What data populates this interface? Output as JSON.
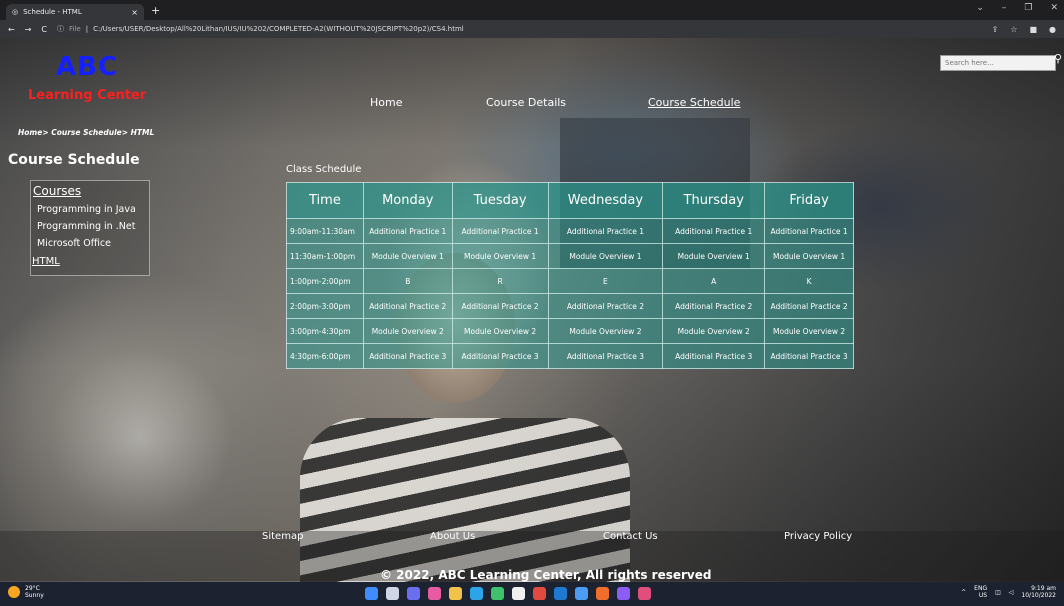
{
  "browser": {
    "tab_title": "Schedule - HTML",
    "tab_close": "×",
    "new_tab": "+",
    "url_prefix": "File",
    "url": "C:/Users/USER/Desktop/All%20Lithan/IUS/IU%202/COMPLETED-A2(WITHOUT%20JSCRIPT%20p2)/CS4.html"
  },
  "header": {
    "logo": "ABC",
    "logo_sub": "Learning Center",
    "search_placeholder": "Search here...",
    "nav": [
      "Home",
      "Course Details",
      "Course Schedule"
    ]
  },
  "breadcrumb": "Home> Course Schedule> HTML",
  "sidebar": {
    "title": "Course Schedule",
    "courses_label": "Courses",
    "items": [
      "Programming in Java",
      "Programming in .Net",
      "Microsoft Office"
    ],
    "current": "HTML"
  },
  "schedule": {
    "caption": "Class Schedule",
    "columns": [
      "Time",
      "Monday",
      "Tuesday",
      "Wednesday",
      "Thursday",
      "Friday"
    ],
    "rows": [
      [
        "9:00am-11:30am",
        "Additional Practice 1",
        "Additional Practice 1",
        "Additional Practice 1",
        "Additional Practice 1",
        "Additional Practice 1"
      ],
      [
        "11:30am-1:00pm",
        "Module Overview 1",
        "Module Overview 1",
        "Module Overview 1",
        "Module Overview 1",
        "Module Overview 1"
      ],
      [
        "1:00pm-2:00pm",
        "B",
        "R",
        "E",
        "A",
        "K"
      ],
      [
        "2:00pm-3:00pm",
        "Additional Practice 2",
        "Additional Practice 2",
        "Additional Practice 2",
        "Additional Practice 2",
        "Additional Practice 2"
      ],
      [
        "3:00pm-4:30pm",
        "Module Overview 2",
        "Module Overview 2",
        "Module Overview 2",
        "Module Overview 2",
        "Module Overview 2"
      ],
      [
        "4:30pm-6:00pm",
        "Additional Practice 3",
        "Additional Practice 3",
        "Additional Practice 3",
        "Additional Practice 3",
        "Additional Practice 3"
      ]
    ]
  },
  "footer": {
    "links": [
      "Sitemap",
      "About Us",
      "Contact Us",
      "Privacy Policy"
    ],
    "copyright": "© 2022, ABC Learning Center, All rights reserved"
  },
  "taskbar": {
    "temp": "29°C",
    "weather": "Sunny",
    "lang": "ENG",
    "region": "US",
    "time": "9:19 am",
    "date": "10/10/2022"
  },
  "colors": {
    "logo": "#1420ff",
    "logo_sub": "#ff1e1e",
    "table_teal": "#2d9b91"
  }
}
